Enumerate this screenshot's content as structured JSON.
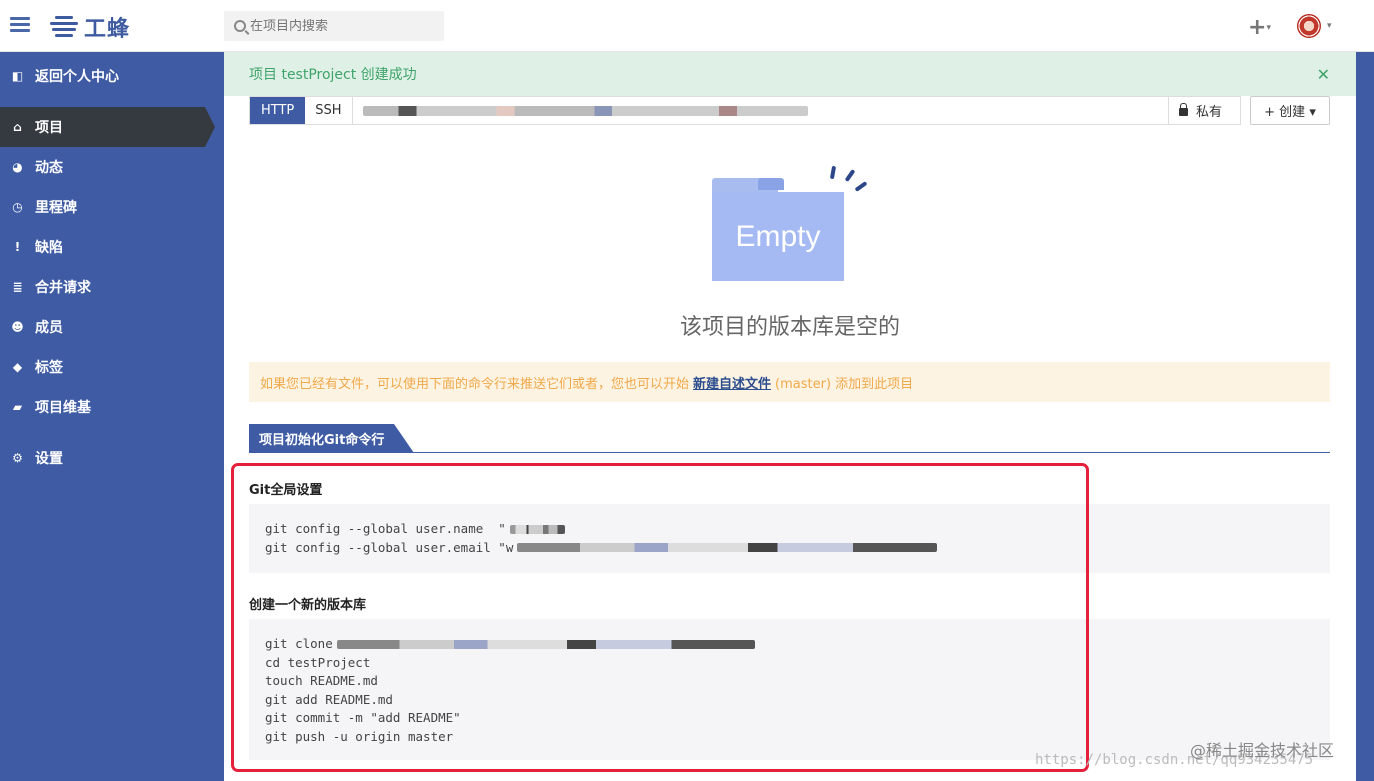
{
  "topbar": {
    "logo_text": "工蜂",
    "search_placeholder": "在项目内搜索",
    "plus_label": "+",
    "caret": "▾"
  },
  "sidebar": {
    "items": [
      {
        "label": "返回个人中心",
        "icon": "back-icon"
      },
      {
        "label": "项目",
        "icon": "home-icon"
      },
      {
        "label": "动态",
        "icon": "dashboard-icon"
      },
      {
        "label": "里程碑",
        "icon": "clock-icon"
      },
      {
        "label": "缺陷",
        "icon": "alert-icon"
      },
      {
        "label": "合并请求",
        "icon": "list-icon"
      },
      {
        "label": "成员",
        "icon": "users-icon"
      },
      {
        "label": "标签",
        "icon": "tag-icon"
      },
      {
        "label": "项目维基",
        "icon": "book-icon"
      },
      {
        "label": "设置",
        "icon": "gears-icon"
      }
    ],
    "icon_glyphs": [
      "◧",
      "⌂",
      "◕",
      "◷",
      "!",
      "≣",
      "☻",
      "◆",
      "▰",
      "⚙"
    ]
  },
  "alert_success": {
    "text": "项目 testProject 创建成功",
    "close": "✕"
  },
  "clone": {
    "tab_http": "HTTP",
    "tab_ssh": "SSH",
    "visibility": "私有",
    "create_label": "+ 创建 ▾"
  },
  "empty": {
    "folder_text": "Empty",
    "title": "该项目的版本库是空的"
  },
  "alert_warning": {
    "text_before": "如果您已经有文件，可以使用下面的命令行来推送它们或者，您也可以开始",
    "link": "新建自述文件",
    "text_after": "(master) 添加到此项目"
  },
  "section_tab": "项目初始化Git命令行",
  "global_setup": {
    "title": "Git全局设置",
    "lines": [
      "git config --global user.name  \"",
      "git config --global user.email \"w"
    ]
  },
  "new_repo": {
    "title": "创建一个新的版本库",
    "lines": [
      "git clone",
      "cd testProject",
      "touch README.md",
      "git add README.md",
      "git commit -m \"add README\"",
      "git push -u origin master"
    ]
  },
  "watermark": "https://blog.csdn.net/qq934235475",
  "watermark2": "@稀土掘金技术社区",
  "colors": {
    "brand": "#3e5ba4",
    "sidebar_active": "#343a40",
    "success_bg": "#dff0e6",
    "success_text": "#3fa46a",
    "warning_bg": "#fdf3e2",
    "warning_text": "#f0a94a",
    "highlight": "#e5203a"
  }
}
